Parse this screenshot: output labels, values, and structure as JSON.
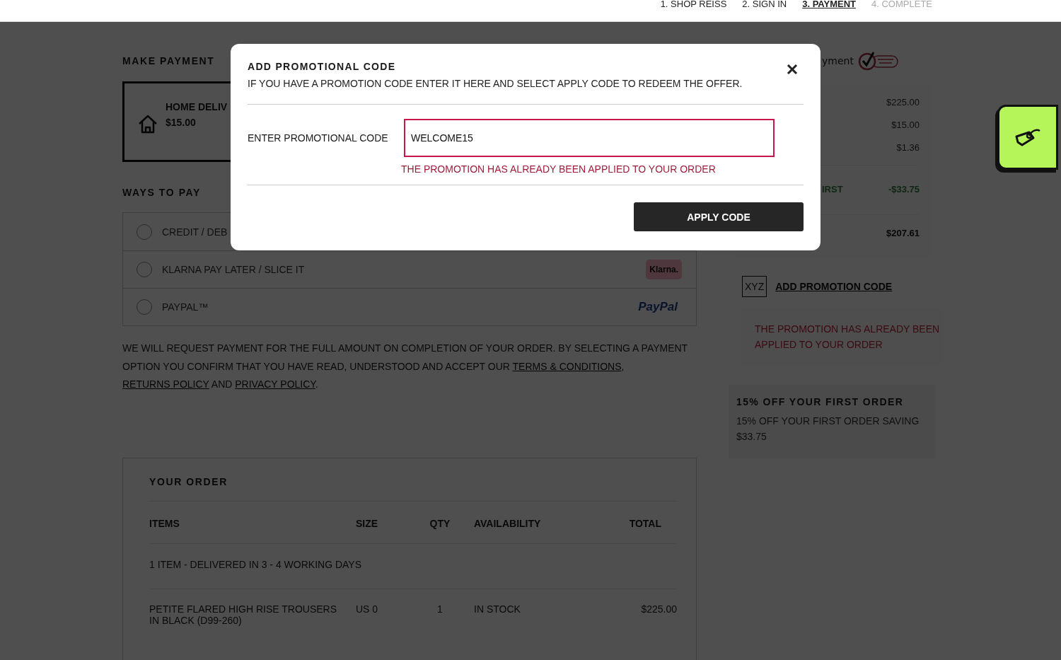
{
  "steps": [
    {
      "label": "1. SHOP REISS",
      "selected": false,
      "disabled": false
    },
    {
      "label": "2. SIGN IN",
      "selected": false,
      "disabled": false
    },
    {
      "label": "3. PAYMENT",
      "selected": true,
      "disabled": false
    },
    {
      "label": "4. COMPLETE",
      "selected": false,
      "disabled": true
    }
  ],
  "payment": {
    "title": "MAKE PAYMENT",
    "delivery": {
      "name": "HOME DELIV",
      "price": "$15.00"
    },
    "ways_title": "WAYS TO PAY",
    "options": [
      {
        "label": "CREDIT / DEB",
        "selected": false
      },
      {
        "label": "KLARNA PAY LATER / SLICE IT",
        "selected": false,
        "logo": "Klarna.",
        "kind": "klarna"
      },
      {
        "label": "PAYPAL™",
        "selected": false,
        "logo": "PayPal",
        "kind": "paypal"
      }
    ],
    "notice": "WE WILL REQUEST PAYMENT FOR THE FULL AMOUNT ON COMPLETION OF YOUR ORDER. BY SELECTING A PAYMENT OPTION YOU CONFIRM THAT YOU HAVE READ, UNDERSTOOD AND ACCEPT OUR ",
    "links": [
      "TERMS & CONDITIONS",
      "RETURNS POLICY",
      "PRIVACY POLICY"
    ],
    "joiners": [
      ",",
      "AND",
      "."
    ]
  },
  "order": {
    "title": "YOUR ORDER",
    "columns": [
      "ITEMS",
      "SIZE",
      "QTY",
      "AVAILABILITY",
      "TOTAL"
    ],
    "group": "1 ITEM - DELIVERED IN 3 - 4 WORKING DAYS",
    "rows": [
      [
        "PETITE FLARED HIGH RISE TROUSERS IN BLACK (D99-260)",
        "US 0",
        "1",
        "IN STOCK",
        "$225.00"
      ]
    ]
  },
  "summary": {
    "trust_label": "yment",
    "rows": [
      {
        "value": "$225.00",
        "kind": "plain"
      },
      {
        "value": "$15.00",
        "kind": "plain"
      },
      {
        "value": "$1.36",
        "kind": "plain"
      },
      {
        "label": "IRST",
        "value": "-$33.75",
        "kind": "discount"
      },
      {
        "value": "$207.61",
        "kind": "total"
      }
    ],
    "promo_badge": "XYZ",
    "promo_link": "ADD PROMOTION CODE",
    "promo_error": "THE PROMOTION HAS ALREADY BEEN APPLIED TO YOUR ORDER",
    "offer_title": "15% OFF YOUR FIRST ORDER",
    "offer_text": "15% OFF YOUR FIRST ORDER SAVING $33.75"
  },
  "modal": {
    "title": "ADD PROMOTIONAL CODE",
    "subtitle": "IF YOU HAVE A PROMOTION CODE ENTER IT HERE AND SELECT APPLY CODE TO REDEEM THE OFFER.",
    "field_label": "ENTER PROMOTIONAL CODE",
    "value": "WELCOME15",
    "error": true,
    "error_text": "THE PROMOTION HAS ALREADY BEEN APPLIED TO YOUR ORDER",
    "button": "APPLY CODE"
  }
}
